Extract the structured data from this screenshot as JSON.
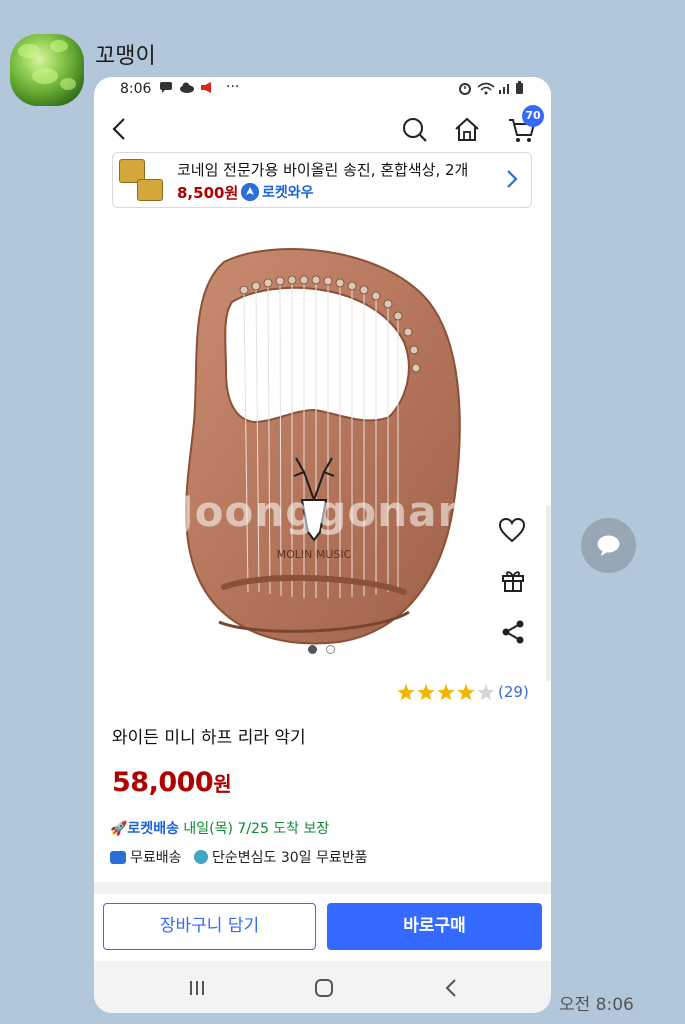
{
  "chat": {
    "sender_name": "꼬맹이",
    "message_time": "오전 8:06"
  },
  "status_bar": {
    "time": "8:06",
    "left_icons": [
      "chat-bubble-icon",
      "cloud-icon",
      "megaphone-icon"
    ],
    "more": "···",
    "right_icons": [
      "alarm-icon",
      "wifi-icon",
      "signal-icon",
      "battery-icon"
    ]
  },
  "app_nav": {
    "cart_count": "70",
    "icons": [
      "back-icon",
      "search-icon",
      "home-icon",
      "cart-icon"
    ]
  },
  "promo": {
    "title": "코네임 전문가용 바이올린 송진, 혼합색상, 2개",
    "price": "8,500원",
    "badge": "로켓와우"
  },
  "product": {
    "image_watermark": "Joonggonara",
    "image_brand_text": "MOLIN MUSIC",
    "rating_value": 4,
    "rating_max": 5,
    "review_count": "(29)",
    "title": "와이든 미니 하프 리라 악기",
    "price": "58,000",
    "price_unit": "원",
    "image_pages": 2,
    "current_image_page": 1
  },
  "delivery": {
    "rocket_label": "🚀로켓배송",
    "date_text": " 내일(목) 7/25 도착 보장",
    "free_shipping": "무료배송",
    "return_policy": "단순변심도 30일 무료반품"
  },
  "buttons": {
    "add_to_cart": "장바구니 담기",
    "buy_now": "바로구매"
  },
  "colors": {
    "accent": "#346aff",
    "price": "#ae0000",
    "rocket_green": "#0f8a35",
    "chat_bg": "#b2c7da"
  }
}
